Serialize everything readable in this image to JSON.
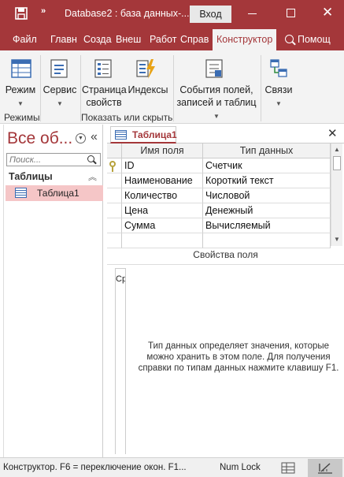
{
  "titlebar": {
    "title": "Database2 : база данных-...",
    "login_label": "Вход"
  },
  "tabs": [
    {
      "label": "Файл"
    },
    {
      "label": "Главн"
    },
    {
      "label": "Созда"
    },
    {
      "label": "Внеш"
    },
    {
      "label": "Работ"
    },
    {
      "label": "Справ"
    },
    {
      "label": "Конструктор"
    }
  ],
  "search_tab": {
    "label": "Помощ"
  },
  "ribbon": {
    "mode_label": "Режим",
    "service_label": "Сервис",
    "page_label_1": "Страница",
    "page_label_2": "свойств",
    "indexes_label": "Индексы",
    "events_label_1": "События полей,",
    "events_label_2": "записей и таблиц",
    "links_label": "Связи",
    "group_modes": "Режимы",
    "group_showhide": "Показать или скрыть"
  },
  "nav": {
    "title": "Все об...",
    "search_placeholder": "Поиск...",
    "group_label": "Таблицы",
    "items": [
      {
        "label": "Таблица1"
      }
    ]
  },
  "doc": {
    "tab_label": "Таблица1"
  },
  "grid": {
    "headers": [
      "Имя поля",
      "Тип данных"
    ],
    "rows": [
      {
        "name": "ID",
        "type": "Счетчик"
      },
      {
        "name": "Наименование",
        "type": "Короткий текст"
      },
      {
        "name": "Количество",
        "type": "Числовой"
      },
      {
        "name": "Цена",
        "type": "Денежный"
      },
      {
        "name": "Сумма",
        "type": "Вычисляемый"
      }
    ]
  },
  "props": {
    "title": "Свойства поля",
    "panel_label": "Ср",
    "help_text": "Тип данных определяет значения, которые можно хранить в этом поле. Для получения справки по типам данных нажмите клавишу F1."
  },
  "status": {
    "text": "Конструктор.  F6 = переключение окон.  F1...",
    "numlock": "Num Lock"
  }
}
